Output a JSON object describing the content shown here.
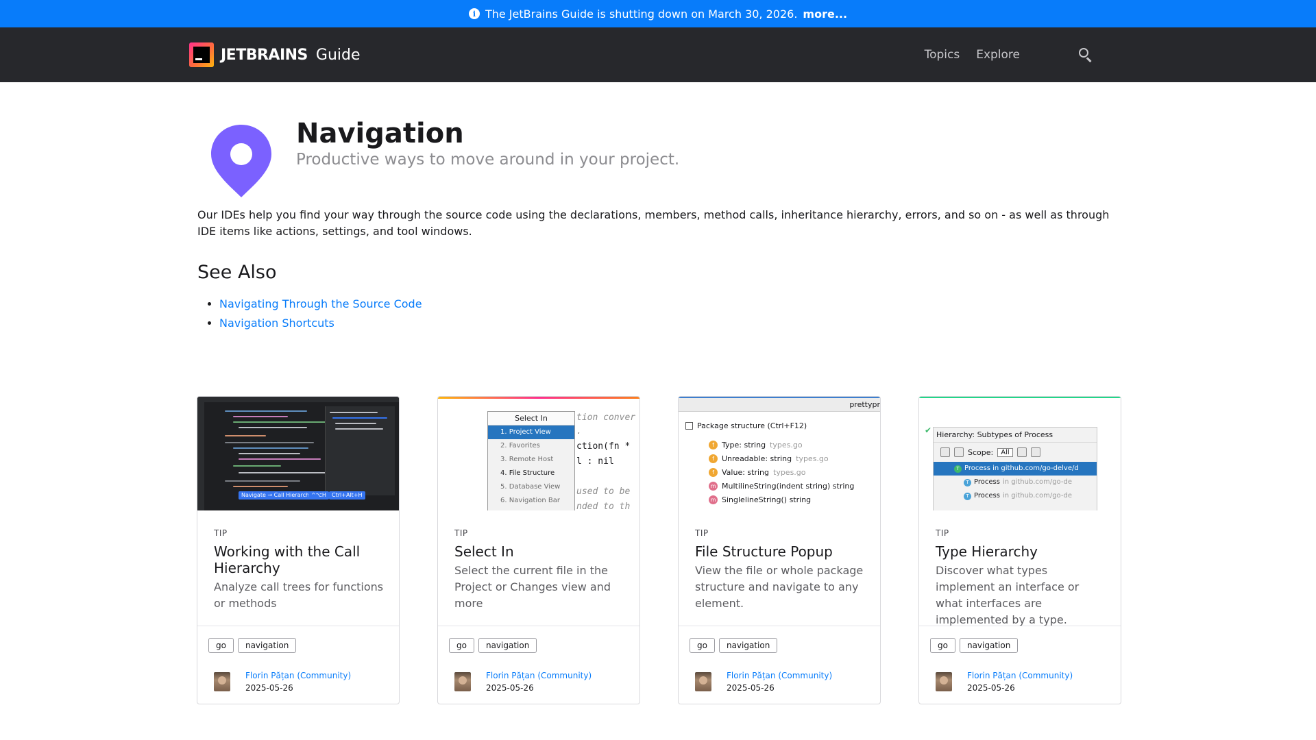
{
  "banner": {
    "text": "The JetBrains Guide is shutting down on March 30, 2026.",
    "more": "more..."
  },
  "header": {
    "logo_text": "JETBRAINS",
    "logo_guide": "Guide",
    "nav": [
      "Topics",
      "Explore"
    ]
  },
  "topic": {
    "title": "Navigation",
    "subtitle": "Productive ways to move around in your project.",
    "intro": "Our IDEs help you find your way through the source code using the declarations, members, method calls, inheritance hierarchy, errors, and so on - as well as through IDE items like actions, settings, and tool windows.",
    "icon_color": "#7b61ff"
  },
  "see_also": {
    "title": "See Also",
    "links": [
      "Navigating Through the Source Code",
      "Navigation Shortcuts"
    ]
  },
  "cards": [
    {
      "kind": "TIP",
      "title": "Working with the Call Hierarchy",
      "desc": "Analyze call trees for functions or methods",
      "tags": [
        "go",
        "navigation"
      ],
      "author": "Florin Pățan (Community)",
      "date": "2025-05-26",
      "shot": {
        "badges": [
          "Navigate → Call Hierarchy",
          "^⌥H",
          "Ctrl+Alt+H"
        ]
      }
    },
    {
      "kind": "TIP",
      "title": "Select In",
      "desc": "Select the current file in the Project or Changes view and more",
      "tags": [
        "go",
        "navigation"
      ],
      "author": "Florin Pățan (Community)",
      "date": "2025-05-26",
      "shot": {
        "popup_title": "Select In",
        "items": [
          "1. Project View",
          "2. Favorites",
          "3. Remote Host",
          "4. File Structure",
          "5. Database View",
          "6. Navigation Bar"
        ],
        "code": [
          "tion conver",
          ".",
          "ction(fn *",
          "l : nil",
          "used to be",
          "nded to th"
        ]
      }
    },
    {
      "kind": "TIP",
      "title": "File Structure Popup",
      "desc": "View the file or whole package structure and navigate to any element.",
      "tags": [
        "go",
        "navigation"
      ],
      "author": "Florin Pățan (Community)",
      "date": "2025-05-26",
      "shot": {
        "tab": "prettypr",
        "header": "Package structure (Ctrl+F12)",
        "rows": [
          {
            "icon": "f",
            "name": "Type: string",
            "type": "types.go"
          },
          {
            "icon": "f",
            "name": "Unreadable: string",
            "type": "types.go"
          },
          {
            "icon": "f",
            "name": "Value: string",
            "type": "types.go"
          },
          {
            "icon": "m",
            "name": "MultilineString(indent string) string",
            "type": ""
          },
          {
            "icon": "m",
            "name": "SinglelineString() string",
            "type": ""
          }
        ]
      }
    },
    {
      "kind": "TIP",
      "title": "Type Hierarchy",
      "desc": "Discover what types implement an interface or what interfaces are implemented by a type.",
      "tags": [
        "go",
        "navigation"
      ],
      "author": "Florin Pățan (Community)",
      "date": "2025-05-26",
      "shot": {
        "header": "Hierarchy:  Subtypes of Process",
        "scope_label": "Scope:",
        "scope_value": "All",
        "root": "Process in github.com/go-delve/d",
        "children": [
          {
            "name": "Process",
            "loc": "in github.com/go-de"
          },
          {
            "name": "Process",
            "loc": "in github.com/go-de"
          }
        ]
      }
    }
  ]
}
